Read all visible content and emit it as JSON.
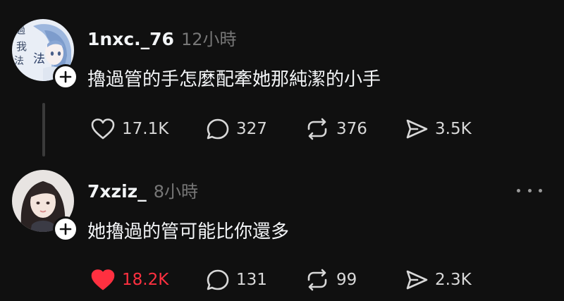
{
  "posts": [
    {
      "username": "1nxc._76",
      "time": "12小時",
      "text": "擼過管的手怎麼配牽她那純潔的小手",
      "avatar_icon": "anime-girl-avatar",
      "avatar_text": [
        "過",
        "我",
        "法",
        "法"
      ],
      "liked": false,
      "stats": {
        "likes": "17.1K",
        "replies": "327",
        "reposts": "376",
        "shares": "3.5K"
      }
    },
    {
      "username": "7xziz_",
      "time": "8小時",
      "text": "她擼過的管可能比你還多",
      "avatar_icon": "girl-photo-avatar",
      "liked": true,
      "stats": {
        "likes": "18.2K",
        "replies": "131",
        "reposts": "99",
        "shares": "2.3K"
      }
    }
  ],
  "colors": {
    "background": "#101010",
    "text": "#f3f5f7",
    "muted": "#777777",
    "like_active": "#ff3040"
  },
  "icons": [
    "heart-icon",
    "comment-icon",
    "repost-icon",
    "share-icon",
    "plus-icon",
    "more-icon"
  ]
}
